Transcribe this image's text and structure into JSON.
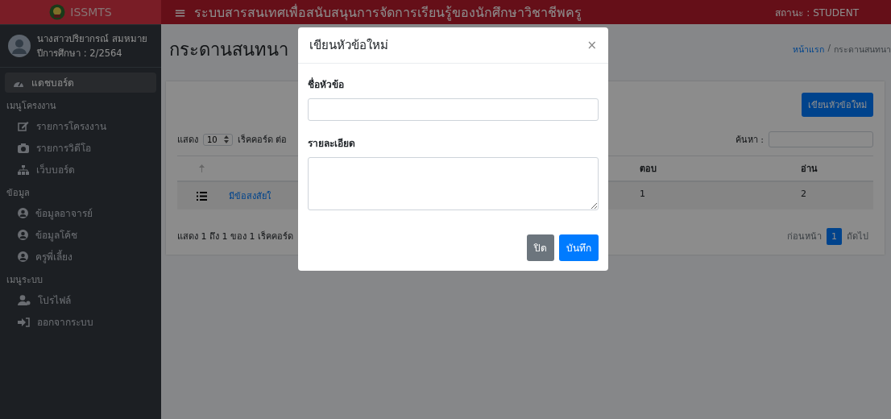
{
  "sidebar": {
    "brand": "ISSMTS",
    "user": {
      "name": "นางสาวปริยากรณ์ สมหมาย",
      "year": "ปีการศึกษา : 2/2564"
    },
    "items": [
      {
        "kind": "link",
        "label": "แดชบอร์ด",
        "selected": true
      },
      {
        "kind": "section",
        "label": "เมนูโครงงาน"
      },
      {
        "kind": "link",
        "label": "รายการโครงงาน",
        "selected": false
      },
      {
        "kind": "link",
        "label": "รายการวิดีโอ",
        "selected": false
      },
      {
        "kind": "link",
        "label": "เว็บบอร์ด",
        "selected": false
      },
      {
        "kind": "section",
        "label": "ข้อมูล"
      },
      {
        "kind": "link",
        "label": "ข้อมูลอาจารย์",
        "selected": false
      },
      {
        "kind": "link",
        "label": "ข้อมูลโค้ช",
        "selected": false
      },
      {
        "kind": "link",
        "label": "ครูพี่เลี้ยง",
        "selected": false
      },
      {
        "kind": "section",
        "label": "เมนูระบบ"
      },
      {
        "kind": "link",
        "label": "โปรไฟล์",
        "selected": false
      },
      {
        "kind": "link",
        "label": "ออกจากระบบ",
        "selected": false
      }
    ]
  },
  "header": {
    "menu": "≡",
    "title": "ระบบสารสนเทศเพื่อสนับสนุนการจัดการเรียนรู้ของนักศึกษาวิชาชีพครู",
    "status": "สถานะ : STUDENT"
  },
  "page": {
    "title": "กระดานสนทนา",
    "breadcrumb": [
      "หน้าแรก",
      "/",
      "กระดานสนทนา"
    ],
    "new_button": "เขียนหัวข้อใหม่",
    "length": {
      "label": "แสดง",
      "value": "10",
      "suffix": "เร็คคอร์ด ต่อ"
    },
    "search_label": "ค้นหา :",
    "table": {
      "columns": [
        "ตอบ",
        "อ่าน"
      ],
      "rows": [
        {
          "topic": "มีข้อสงสัยใ",
          "replies": "1",
          "reads": "2"
        }
      ]
    },
    "info": "แสดง 1 ถึง 1 ของ 1 เร็คคอร์ด",
    "pagination": [
      {
        "label": "ก่อนหน้า",
        "selected": false
      },
      {
        "label": "1",
        "selected": true
      },
      {
        "label": "ถัดไป",
        "selected": false
      }
    ]
  },
  "modal": {
    "title": "เขียนหัวข้อใหม่",
    "close": "×",
    "fields": [
      {
        "kind": "input",
        "label": "ชื่อหัวข้อ"
      },
      {
        "kind": "textarea",
        "label": "รายละเอียด"
      }
    ],
    "buttons": [
      {
        "kind": "secondary",
        "label": "ปิด"
      },
      {
        "kind": "primary",
        "label": "บันทึก"
      }
    ]
  }
}
